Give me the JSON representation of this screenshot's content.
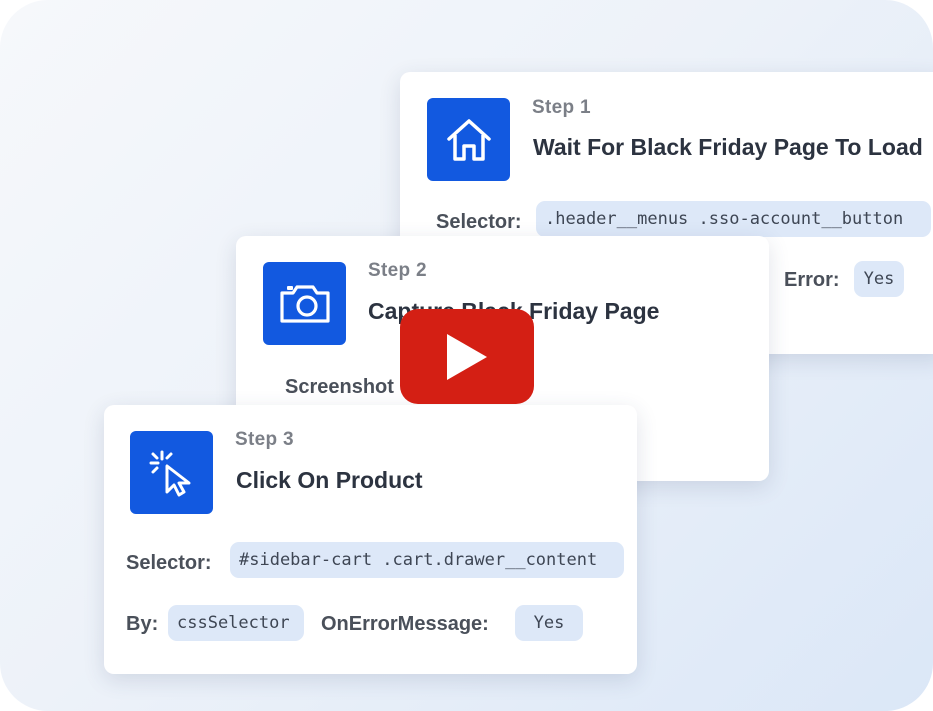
{
  "steps": [
    {
      "label": "Step 1",
      "title": "Wait For Black Friday Page To Load",
      "icon": "home-icon",
      "selector_label": "Selector:",
      "selector_value": ".header__menus .sso-account__button",
      "error_label": "Error:",
      "error_value": "Yes"
    },
    {
      "label": "Step 2",
      "title": "Capture Black Friday Page",
      "icon": "camera-icon",
      "screenshot_label": "Screenshot"
    },
    {
      "label": "Step 3",
      "title": "Click On Product",
      "icon": "cursor-click-icon",
      "selector_label": "Selector:",
      "selector_value": "#sidebar-cart .cart.drawer__content",
      "by_label": "By:",
      "by_value": "cssSelector",
      "error_label": "OnErrorMessage:",
      "error_value": "Yes"
    }
  ],
  "video": {
    "icon": "play-icon",
    "color": "#d41f14"
  },
  "colors": {
    "accent": "#1259e0",
    "chip": "#dde8f8"
  }
}
